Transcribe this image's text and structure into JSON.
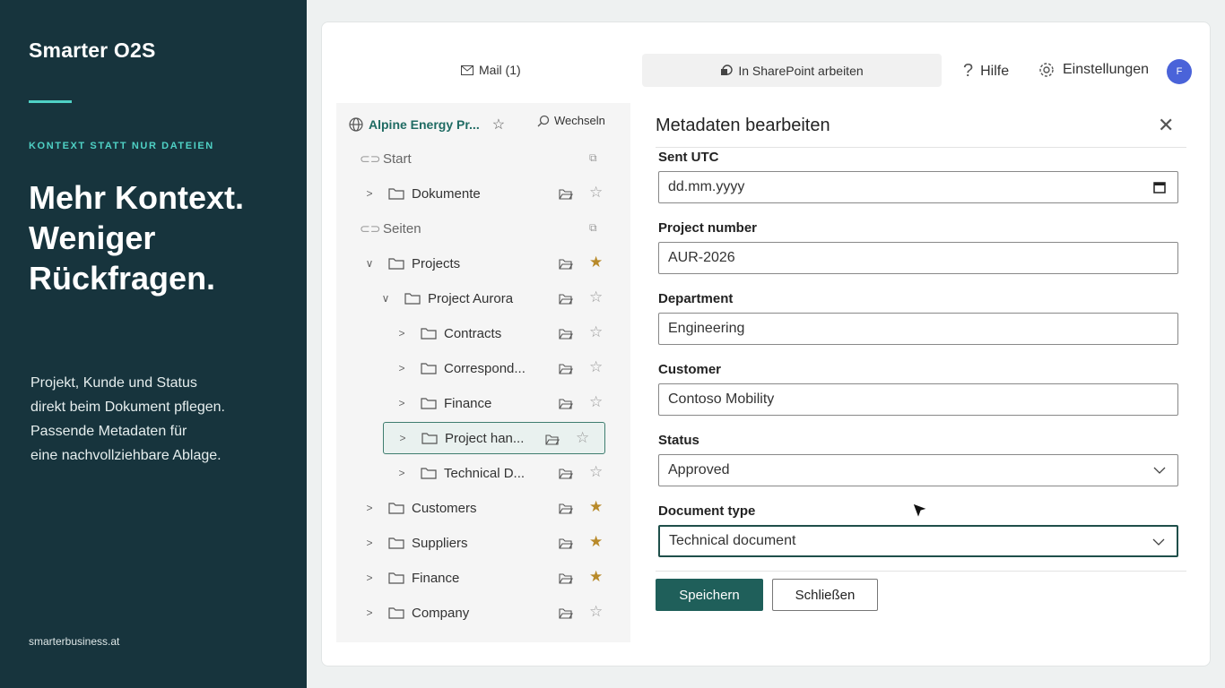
{
  "left_panel": {
    "brand": "Smarter O2S",
    "kicker": "KONTEXT STATT NUR DATEIEN",
    "headline": [
      "Mehr Kontext.",
      "Weniger",
      "Rückfragen."
    ],
    "description": [
      "Projekt, Kunde und Status",
      "direkt beim Dokument pflegen.",
      "Passende Metadaten für",
      "eine nachvollziehbare Ablage."
    ],
    "footer_url": "smarterbusiness.at",
    "accent_color": "#4fd1c5",
    "background_color": "#17343d"
  },
  "topbar": {
    "mail_label": "Mail (1)",
    "sharepoint_label": "In SharePoint arbeiten",
    "help_label": "Hilfe",
    "settings_label": "Einstellungen",
    "avatar_initial": "F"
  },
  "nav": {
    "site_name": "Alpine Energy Pr...",
    "switch_label": "Wechseln",
    "items": [
      {
        "label": "Start",
        "kind": "page"
      },
      {
        "label": "Dokumente",
        "kind": "folder",
        "starred": false
      },
      {
        "label": "Seiten",
        "kind": "page"
      },
      {
        "label": "Projects",
        "kind": "folder",
        "starred": true,
        "expanded": true
      },
      {
        "label": "Project Aurora",
        "kind": "folder",
        "starred": false,
        "expanded": true
      },
      {
        "label": "Contracts",
        "kind": "folder",
        "starred": false
      },
      {
        "label": "Correspond...",
        "kind": "folder",
        "starred": false
      },
      {
        "label": "Finance",
        "kind": "folder",
        "starred": false
      },
      {
        "label": "Project han...",
        "kind": "folder",
        "starred": false,
        "selected": true
      },
      {
        "label": "Technical D...",
        "kind": "folder",
        "starred": false
      },
      {
        "label": "Customers",
        "kind": "folder",
        "starred": true
      },
      {
        "label": "Suppliers",
        "kind": "folder",
        "starred": true
      },
      {
        "label": "Finance",
        "kind": "folder",
        "starred": true
      },
      {
        "label": "Company",
        "kind": "folder",
        "starred": false
      }
    ]
  },
  "panel": {
    "title": "Metadaten bearbeiten",
    "fields": [
      {
        "label": "Sent UTC",
        "value": "dd.mm.yyyy",
        "type": "date"
      },
      {
        "label": "Project number",
        "value": "AUR-2026",
        "type": "text"
      },
      {
        "label": "Department",
        "value": "Engineering",
        "type": "text"
      },
      {
        "label": "Customer",
        "value": "Contoso Mobility",
        "type": "text"
      },
      {
        "label": "Status",
        "value": "Approved",
        "type": "select"
      },
      {
        "label": "Document type",
        "value": "Technical document",
        "type": "select",
        "focused": true
      }
    ],
    "save_label": "Speichern",
    "close_label": "Schließen",
    "primary_color": "#1f5f5a"
  }
}
